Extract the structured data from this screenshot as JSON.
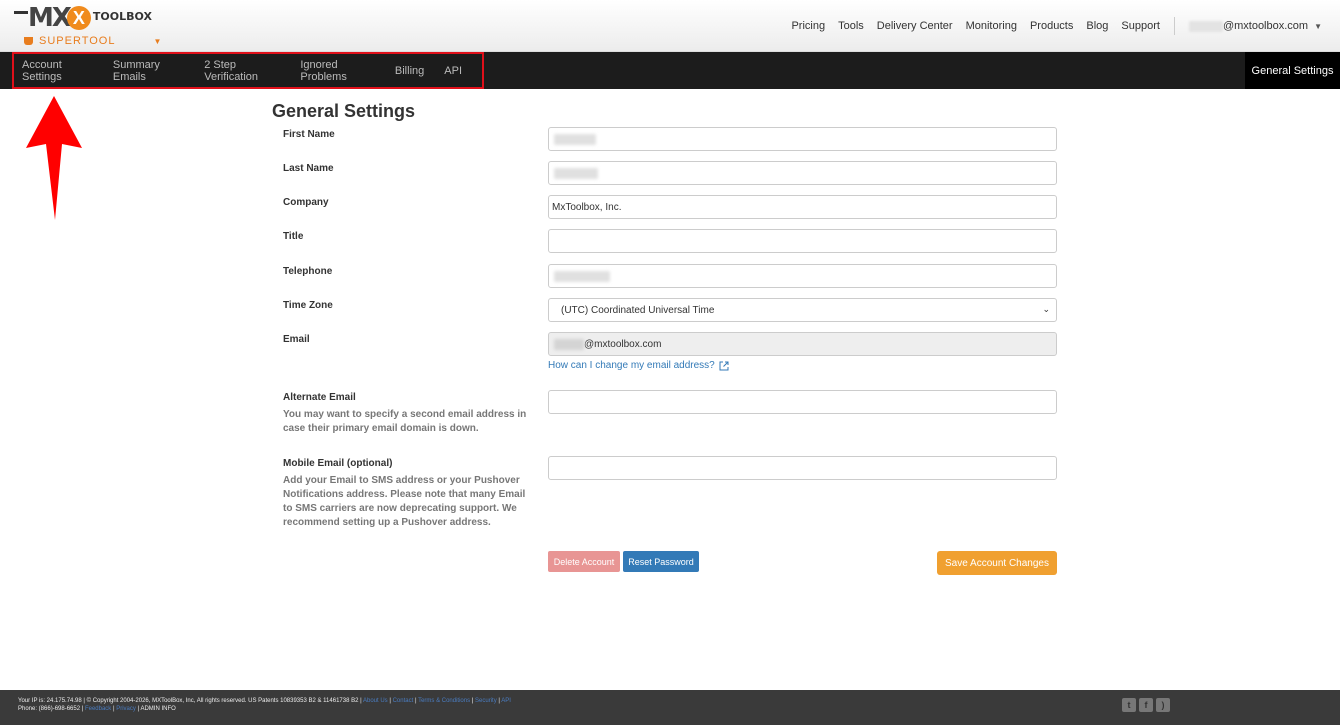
{
  "header": {
    "logo_text": "MX",
    "logo_x": "X",
    "logo_toolbox": "TOOLBOX",
    "logo_sub": "SUPERTOOL",
    "nav": [
      "Pricing",
      "Tools",
      "Delivery Center",
      "Monitoring",
      "Products",
      "Blog",
      "Support"
    ],
    "user_email": "@mxtoolbox.com"
  },
  "subnav": {
    "items": [
      "Account Settings",
      "Summary Emails",
      "2 Step Verification",
      "Ignored Problems",
      "Billing",
      "API"
    ],
    "active_right": "General Settings"
  },
  "form": {
    "title": "General Settings",
    "first_name_label": "First Name",
    "last_name_label": "Last Name",
    "company_label": "Company",
    "company_value": "MxToolbox, Inc.",
    "title_label": "Title",
    "telephone_label": "Telephone",
    "timezone_label": "Time Zone",
    "timezone_value": "(UTC) Coordinated Universal Time",
    "email_label": "Email",
    "email_value": "@mxtoolbox.com",
    "email_help_link": "How can I change my email address?",
    "alt_email_label": "Alternate Email",
    "alt_email_help": "You may want to specify a second email address in case their primary email domain is down.",
    "mobile_email_label": "Mobile Email (optional)",
    "mobile_email_help": "Add your Email to SMS address or your Pushover Notifications address. Please note that many Email to SMS carriers are now deprecating support. We recommend setting up a Pushover address.",
    "delete_button": "Delete Account",
    "reset_button": "Reset Password",
    "save_button": "Save Account Changes"
  },
  "footer": {
    "line1": "Your IP is: 24.175.74.98 | © Copyright 2004-2026, MXToolBox, Inc, All rights reserved. US Patents 10839353 B2 & 11461738 B2 |",
    "line1_links": [
      "About Us",
      "Contact",
      "Terms & Conditions",
      "Security",
      "API"
    ],
    "line2_phone": "Phone: (866)-698-6652 |",
    "line2_links": [
      "Feedback",
      "Privacy"
    ],
    "line2_admin": "| ADMIN INFO"
  },
  "colors": {
    "accent_orange": "#f0a030",
    "link_blue": "#337ab7",
    "highlight_red": "#e0101a",
    "nav_dark": "#1c1c1c"
  }
}
